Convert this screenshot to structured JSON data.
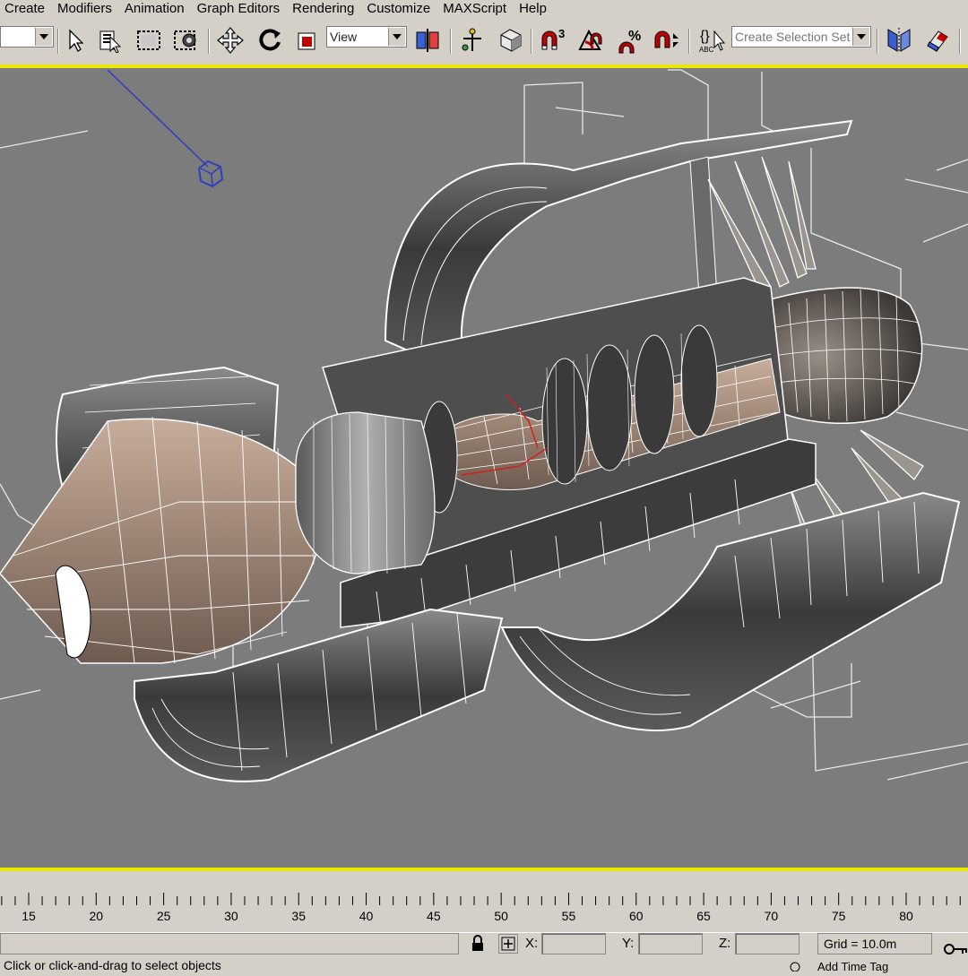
{
  "menu": [
    "Create",
    "Modifiers",
    "Animation",
    "Graph Editors",
    "Rendering",
    "Customize",
    "MAXScript",
    "Help"
  ],
  "toolbar": {
    "selection_filter": "",
    "reference_coord": "View",
    "named_selection_placeholder": "Create Selection Set",
    "snap_3_label": "3",
    "percent_label": "%",
    "abc_label": "ABC"
  },
  "timeline": {
    "ticks": [
      "15",
      "20",
      "25",
      "30",
      "35",
      "40",
      "45",
      "50",
      "55",
      "60",
      "65",
      "70",
      "75",
      "80"
    ]
  },
  "status": {
    "x_label": "X:",
    "y_label": "Y:",
    "z_label": "Z:",
    "x_value": "",
    "y_value": "",
    "z_value": "",
    "grid": "Grid = 10.0m",
    "prompt": "Click or click-and-drag to select objects",
    "key_label": "Add Time Tag"
  },
  "colors": {
    "viewport_bg": "#7c7c7c",
    "active_border": "#e9e600",
    "ui_gray": "#d4d0c8",
    "wire": "#ffffff",
    "engine_tan": "#b29a8a",
    "camera_line": "#2b3fbf"
  }
}
